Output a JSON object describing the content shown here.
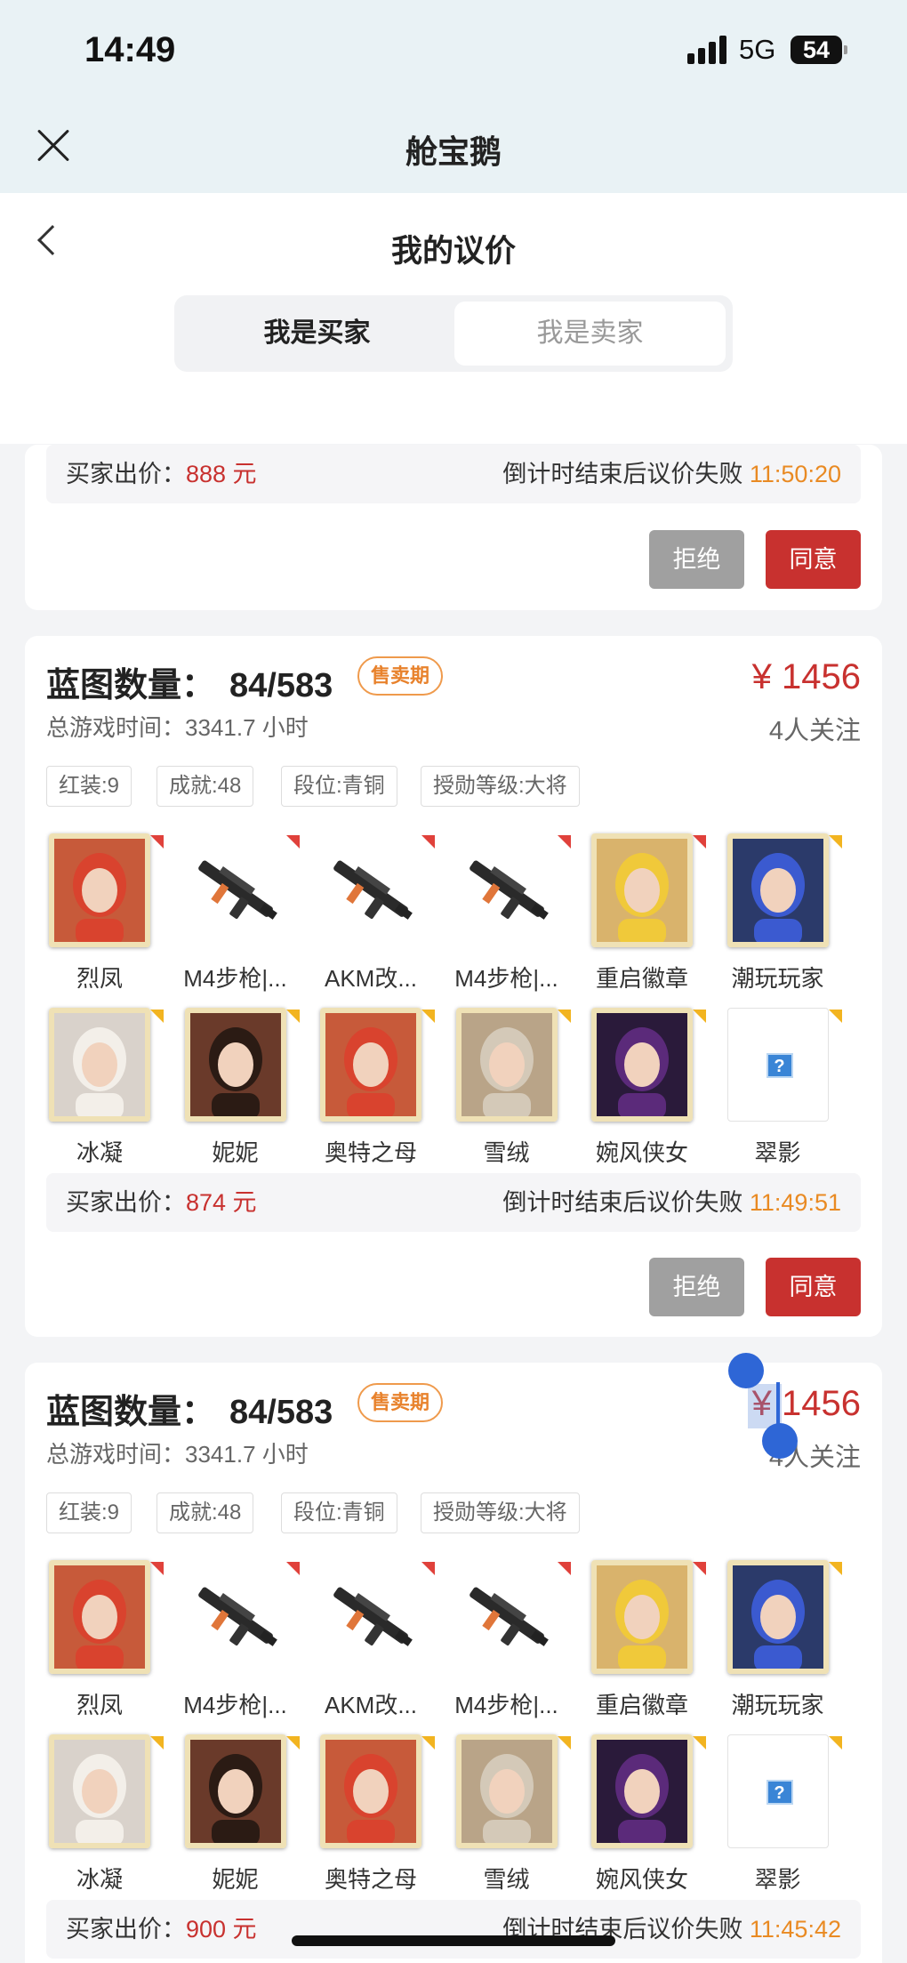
{
  "status_bar": {
    "time": "14:49",
    "network": "5G",
    "battery": "54"
  },
  "app_title": "舱宝鹅",
  "page_title": "我的议价",
  "tabs": [
    "我是买家",
    "我是卖家"
  ],
  "offer_label": "买家出价：",
  "countdown_label": "倒计时结束后议价失败",
  "reject_label": "拒绝",
  "agree_label": "同意",
  "cards": [
    {
      "offer_price": "888 元",
      "countdown": "11:50:20"
    },
    {
      "heading_label": "蓝图数量：",
      "count": "84/583",
      "tag": "售卖期",
      "price": "¥ 1456",
      "playtime": "总游戏时间：3341.7 小时",
      "followers": "4人关注",
      "chips": [
        "红装:9",
        "成就:48",
        "段位:青铜",
        "授勋等级:大将"
      ],
      "offer_price": "874 元",
      "countdown": "11:49:51"
    },
    {
      "heading_label": "蓝图数量：",
      "count": "84/583",
      "tag": "售卖期",
      "price": "¥ 1456",
      "playtime": "总游戏时间：3341.7 小时",
      "followers": "4人关注",
      "chips": [
        "红装:9",
        "成就:48",
        "段位:青铜",
        "授勋等级:大将"
      ],
      "offer_price": "900 元",
      "countdown": "11:45:42"
    }
  ],
  "items": [
    {
      "name": "烈凤",
      "kind": "character",
      "rarity": "red"
    },
    {
      "name": "M4步枪|...",
      "kind": "weapon",
      "rarity": "red"
    },
    {
      "name": "AKM改...",
      "kind": "weapon",
      "rarity": "red"
    },
    {
      "name": "M4步枪|...",
      "kind": "weapon",
      "rarity": "red"
    },
    {
      "name": "重启徽章",
      "kind": "character",
      "rarity": "red"
    },
    {
      "name": "潮玩玩家",
      "kind": "character",
      "rarity": "yellow"
    },
    {
      "name": "冰凝",
      "kind": "character",
      "rarity": "yellow"
    },
    {
      "name": "妮妮",
      "kind": "character",
      "rarity": "yellow"
    },
    {
      "name": "奥特之母",
      "kind": "character",
      "rarity": "yellow"
    },
    {
      "name": "雪绒",
      "kind": "character",
      "rarity": "yellow"
    },
    {
      "name": "婉风侠女",
      "kind": "character",
      "rarity": "yellow"
    },
    {
      "name": "翠影",
      "kind": "unknown",
      "rarity": "yellow"
    }
  ],
  "colors": {
    "accent_red": "#c8312f",
    "countdown_orange": "#e98a23",
    "tag_orange": "#e8822c",
    "header_bg": "#e9f2f5"
  },
  "icons": {
    "close": "close-icon",
    "back": "chevron-left-icon",
    "unknown": "question-mark-icon"
  }
}
